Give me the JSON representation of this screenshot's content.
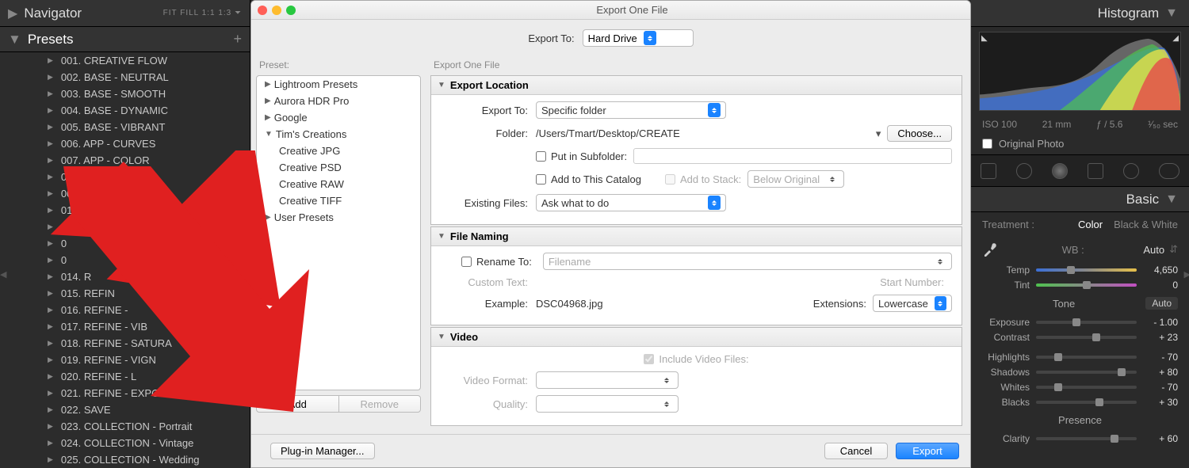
{
  "left": {
    "navigator_title": "Navigator",
    "navigator_ratios": "FIT   FILL   1:1   1:3  ⏷",
    "presets_title": "Presets",
    "items": [
      "001. CREATIVE FLOW",
      "002. BASE - NEUTRAL",
      "003. BASE - SMOOTH",
      "004. BASE - DYNAMIC",
      "005. BASE - VIBRANT",
      "006. APP - CURVES",
      "007. APP - COLOR",
      "008. APP - TEMP",
      "009. A",
      "01",
      "0",
      "0",
      "0",
      "014. R",
      "015. REFIN",
      "016. REFINE -",
      "017. REFINE - VIB",
      "018. REFINE - SATURA",
      "019. REFINE - VIGN",
      "020. REFINE - L",
      "021. REFINE - EXPOSURE",
      "022. SAVE",
      "023. COLLECTION - Portrait",
      "024. COLLECTION - Vintage",
      "025. COLLECTION - Wedding"
    ]
  },
  "modal": {
    "title": "Export One File",
    "export_to_label": "Export To:",
    "export_to_value": "Hard Drive",
    "preset_label": "Preset:",
    "settings_label": "Export One File",
    "preset_folders": [
      {
        "label": "Lightroom Presets",
        "expanded": false
      },
      {
        "label": "Aurora HDR Pro",
        "expanded": false
      },
      {
        "label": "Google",
        "expanded": false
      },
      {
        "label": "Tim's Creations",
        "expanded": true,
        "children": [
          "Creative JPG",
          "Creative PSD",
          "Creative RAW",
          "Creative TIFF"
        ]
      },
      {
        "label": "User Presets",
        "expanded": false
      }
    ],
    "add": "Add",
    "remove": "Remove",
    "plugin_manager": "Plug-in Manager...",
    "cancel": "Cancel",
    "export": "Export",
    "loc": {
      "header": "Export Location",
      "export_to_label": "Export To:",
      "export_to_value": "Specific folder",
      "folder_label": "Folder:",
      "folder_path": "/Users/Tmart/Desktop/CREATE",
      "choose": "Choose...",
      "put_subfolder": "Put in Subfolder:",
      "add_catalog": "Add to This Catalog",
      "add_stack": "Add to Stack:",
      "stack_value": "Below Original",
      "existing_label": "Existing Files:",
      "existing_value": "Ask what to do"
    },
    "naming": {
      "header": "File Naming",
      "rename_to": "Rename To:",
      "rename_value": "Filename",
      "custom_text": "Custom Text:",
      "start_number": "Start Number:",
      "example_label": "Example:",
      "example_value": "DSC04968.jpg",
      "extensions_label": "Extensions:",
      "extensions_value": "Lowercase"
    },
    "video": {
      "header": "Video",
      "include": "Include Video Files:",
      "format_label": "Video Format:",
      "quality_label": "Quality:"
    }
  },
  "right": {
    "histogram_title": "Histogram",
    "iso": "ISO 100",
    "focal": "21 mm",
    "aperture": "ƒ / 5.6",
    "shutter": "¹⁄₅₀ sec",
    "original_photo": "Original Photo",
    "basic_title": "Basic",
    "treatment_label": "Treatment :",
    "treatment_color": "Color",
    "treatment_bw": "Black & White",
    "wb_label": "WB :",
    "wb_value": "Auto",
    "tone_label": "Tone",
    "presence_label": "Presence",
    "auto": "Auto",
    "sliders": {
      "temp": {
        "label": "Temp",
        "value": "4,650",
        "pos": 35
      },
      "tint": {
        "label": "Tint",
        "value": "0",
        "pos": 50
      },
      "exposure": {
        "label": "Exposure",
        "value": "- 1.00",
        "pos": 40
      },
      "contrast": {
        "label": "Contrast",
        "value": "+ 23",
        "pos": 60
      },
      "highlights": {
        "label": "Highlights",
        "value": "- 70",
        "pos": 22
      },
      "shadows": {
        "label": "Shadows",
        "value": "+ 80",
        "pos": 85
      },
      "whites": {
        "label": "Whites",
        "value": "- 70",
        "pos": 22
      },
      "blacks": {
        "label": "Blacks",
        "value": "+ 30",
        "pos": 63
      },
      "clarity": {
        "label": "Clarity",
        "value": "+ 60",
        "pos": 78
      }
    }
  }
}
